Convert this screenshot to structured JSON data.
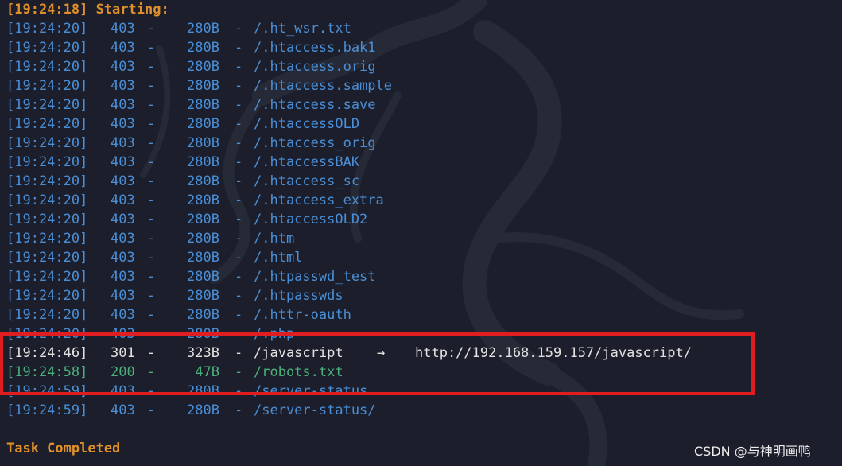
{
  "terminal": {
    "start_line": "[19:24:18] Starting:",
    "completed_line": "Task Completed",
    "arrow": "→",
    "colors": {
      "background": "#1c1f2b",
      "status_403": "#4a8ed6",
      "status_301": "#e2e2e2",
      "status_200": "#4cb07a",
      "header": "#e0902a",
      "highlight_border": "#e01e22"
    },
    "rows": [
      {
        "time": "[19:24:20]",
        "code": "403",
        "dash": "-",
        "size": "280B",
        "sep": "-",
        "path": "/.ht_wsr.txt",
        "status": "403",
        "redirect": ""
      },
      {
        "time": "[19:24:20]",
        "code": "403",
        "dash": "-",
        "size": "280B",
        "sep": "-",
        "path": "/.htaccess.bak1",
        "status": "403",
        "redirect": ""
      },
      {
        "time": "[19:24:20]",
        "code": "403",
        "dash": "-",
        "size": "280B",
        "sep": "-",
        "path": "/.htaccess.orig",
        "status": "403",
        "redirect": ""
      },
      {
        "time": "[19:24:20]",
        "code": "403",
        "dash": "-",
        "size": "280B",
        "sep": "-",
        "path": "/.htaccess.sample",
        "status": "403",
        "redirect": ""
      },
      {
        "time": "[19:24:20]",
        "code": "403",
        "dash": "-",
        "size": "280B",
        "sep": "-",
        "path": "/.htaccess.save",
        "status": "403",
        "redirect": ""
      },
      {
        "time": "[19:24:20]",
        "code": "403",
        "dash": "-",
        "size": "280B",
        "sep": "-",
        "path": "/.htaccessOLD",
        "status": "403",
        "redirect": ""
      },
      {
        "time": "[19:24:20]",
        "code": "403",
        "dash": "-",
        "size": "280B",
        "sep": "-",
        "path": "/.htaccess_orig",
        "status": "403",
        "redirect": ""
      },
      {
        "time": "[19:24:20]",
        "code": "403",
        "dash": "-",
        "size": "280B",
        "sep": "-",
        "path": "/.htaccessBAK",
        "status": "403",
        "redirect": ""
      },
      {
        "time": "[19:24:20]",
        "code": "403",
        "dash": "-",
        "size": "280B",
        "sep": "-",
        "path": "/.htaccess_sc",
        "status": "403",
        "redirect": ""
      },
      {
        "time": "[19:24:20]",
        "code": "403",
        "dash": "-",
        "size": "280B",
        "sep": "-",
        "path": "/.htaccess_extra",
        "status": "403",
        "redirect": ""
      },
      {
        "time": "[19:24:20]",
        "code": "403",
        "dash": "-",
        "size": "280B",
        "sep": "-",
        "path": "/.htaccessOLD2",
        "status": "403",
        "redirect": ""
      },
      {
        "time": "[19:24:20]",
        "code": "403",
        "dash": "-",
        "size": "280B",
        "sep": "-",
        "path": "/.htm",
        "status": "403",
        "redirect": ""
      },
      {
        "time": "[19:24:20]",
        "code": "403",
        "dash": "-",
        "size": "280B",
        "sep": "-",
        "path": "/.html",
        "status": "403",
        "redirect": ""
      },
      {
        "time": "[19:24:20]",
        "code": "403",
        "dash": "-",
        "size": "280B",
        "sep": "-",
        "path": "/.htpasswd_test",
        "status": "403",
        "redirect": ""
      },
      {
        "time": "[19:24:20]",
        "code": "403",
        "dash": "-",
        "size": "280B",
        "sep": "-",
        "path": "/.htpasswds",
        "status": "403",
        "redirect": ""
      },
      {
        "time": "[19:24:20]",
        "code": "403",
        "dash": "-",
        "size": "280B",
        "sep": "-",
        "path": "/.httr-oauth",
        "status": "403",
        "redirect": ""
      },
      {
        "time": "[19:24:20]",
        "code": "403",
        "dash": "-",
        "size": "280B",
        "sep": "-",
        "path": "/.php",
        "status": "403",
        "redirect": ""
      },
      {
        "time": "[19:24:46]",
        "code": "301",
        "dash": "-",
        "size": "323B",
        "sep": "-",
        "path": "/javascript",
        "status": "301",
        "redirect": "http://192.168.159.157/javascript/"
      },
      {
        "time": "[19:24:58]",
        "code": "200",
        "dash": "-",
        "size": "47B",
        "sep": "-",
        "path": "/robots.txt",
        "status": "200",
        "redirect": ""
      },
      {
        "time": "[19:24:59]",
        "code": "403",
        "dash": "-",
        "size": "280B",
        "sep": "-",
        "path": "/server-status",
        "status": "403",
        "redirect": ""
      },
      {
        "time": "[19:24:59]",
        "code": "403",
        "dash": "-",
        "size": "280B",
        "sep": "-",
        "path": "/server-status/",
        "status": "403",
        "redirect": ""
      }
    ]
  },
  "watermark": "CSDN @与神明画鸭"
}
